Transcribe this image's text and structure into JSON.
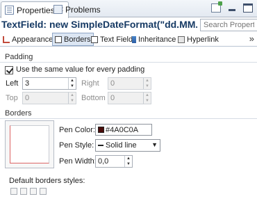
{
  "tabs": [
    {
      "label": "Properties",
      "close": "✕",
      "active": true
    },
    {
      "label": "Problems",
      "active": false
    }
  ],
  "header": {
    "title": "TextField: new SimpleDateFormat(\"dd.MM.YY...",
    "search_placeholder": "Search Property"
  },
  "section_tabs": [
    {
      "label": "Appearance"
    },
    {
      "label": "Borders",
      "selected": true
    },
    {
      "label": "Text Field"
    },
    {
      "label": "Inheritance"
    },
    {
      "label": "Hyperlink"
    }
  ],
  "overflow_chevron": "»",
  "padding": {
    "group_label": "Padding",
    "same_value_label": "Use the same value for every padding",
    "same_value_checked": true,
    "left_label": "Left",
    "left_value": "3",
    "right_label": "Right",
    "right_value": "0",
    "top_label": "Top",
    "top_value": "0",
    "bottom_label": "Bottom",
    "bottom_value": "0"
  },
  "borders": {
    "group_label": "Borders",
    "pen_color_label": "Pen Color:",
    "pen_color_value": "#4A0C0A",
    "pen_style_label": "Pen Style:",
    "pen_style_value": "Solid line",
    "pen_width_label": "Pen Width:",
    "pen_width_value": "0,0",
    "default_styles_label": "Default borders styles:"
  },
  "colors": {
    "accent": "#163a64",
    "pen_color": "#4a0c0a"
  }
}
